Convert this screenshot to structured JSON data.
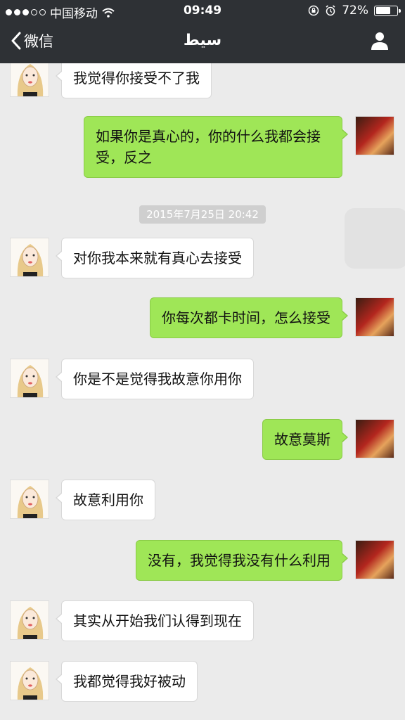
{
  "status_bar": {
    "carrier": "中国移动",
    "time": "09:49",
    "battery_percent": "72%",
    "battery_level": 0.72
  },
  "nav": {
    "back_label": "微信",
    "title": "سيط"
  },
  "chat": {
    "timestamp": "2015年7月25日 20:42",
    "messages": [
      {
        "side": "left",
        "text": "我觉得你接受不了我"
      },
      {
        "side": "right",
        "text": "如果你是真心的，你的什么我都会接受，反之"
      },
      {
        "side": "left",
        "text": "对你我本来就有真心去接受"
      },
      {
        "side": "right",
        "text": "你每次都卡时间，怎么接受"
      },
      {
        "side": "left",
        "text": "你是不是觉得我故意你用你"
      },
      {
        "side": "right",
        "text": "故意莫斯"
      },
      {
        "side": "left",
        "text": "故意利用你"
      },
      {
        "side": "right",
        "text": "没有，我觉得我没有什么利用"
      },
      {
        "side": "left",
        "text": "其实从开始我们认得到现在"
      },
      {
        "side": "left",
        "text": "我都觉得我好被动"
      }
    ]
  },
  "colors": {
    "nav_bg": "#2e3135",
    "chat_bg": "#ebebeb",
    "my_bubble": "#9fe657",
    "their_bubble": "#ffffff"
  }
}
